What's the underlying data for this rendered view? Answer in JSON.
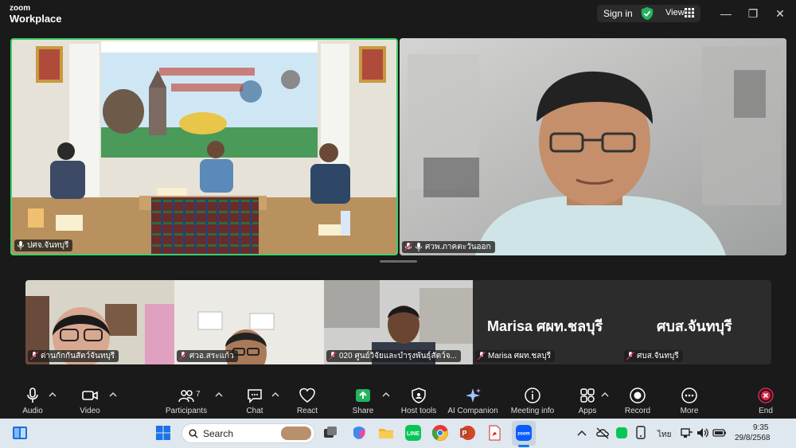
{
  "app": {
    "logo_top": "zoom",
    "logo_bottom": "Workplace"
  },
  "titlebar": {
    "signin_label": "Sign in",
    "view_label": "View"
  },
  "colors": {
    "active_speaker_border": "#3ccf6e",
    "share_green": "#22b35e",
    "end_red": "#e0264a",
    "shield_green": "#22b35e"
  },
  "main_tiles": [
    {
      "name": "ปศจ.จันทบุรี",
      "muted": false
    },
    {
      "name": "ศวพ.ภาคตะวันออก",
      "muted": true
    }
  ],
  "gallery": [
    {
      "name": "ด่านกักกันสัตว์จันทบุรี",
      "video": true
    },
    {
      "name": "ศวอ.สระแก้ว",
      "video": true
    },
    {
      "name": "020 ศูนย์วิจัยและบำรุงพันธุ์สัตว์จ...",
      "video": true
    },
    {
      "name": "Marisa ศผท.ชลบุรี",
      "display_name": "Marisa ศผท.ชลบุรี",
      "video": false
    },
    {
      "name": "ศบส.จันทบุรี",
      "display_name": "ศบส.จันทบุรี",
      "video": false
    }
  ],
  "toolbar": {
    "audio": "Audio",
    "video": "Video",
    "participants": "Participants",
    "participants_count": "7",
    "chat": "Chat",
    "react": "React",
    "share": "Share",
    "host_tools": "Host tools",
    "ai_companion": "AI Companion",
    "meeting_info": "Meeting info",
    "apps": "Apps",
    "record": "Record",
    "more": "More",
    "end": "End"
  },
  "taskbar": {
    "search_placeholder": "Search",
    "language": "ไทย",
    "time": "9:35",
    "date": "29/8/2568"
  }
}
